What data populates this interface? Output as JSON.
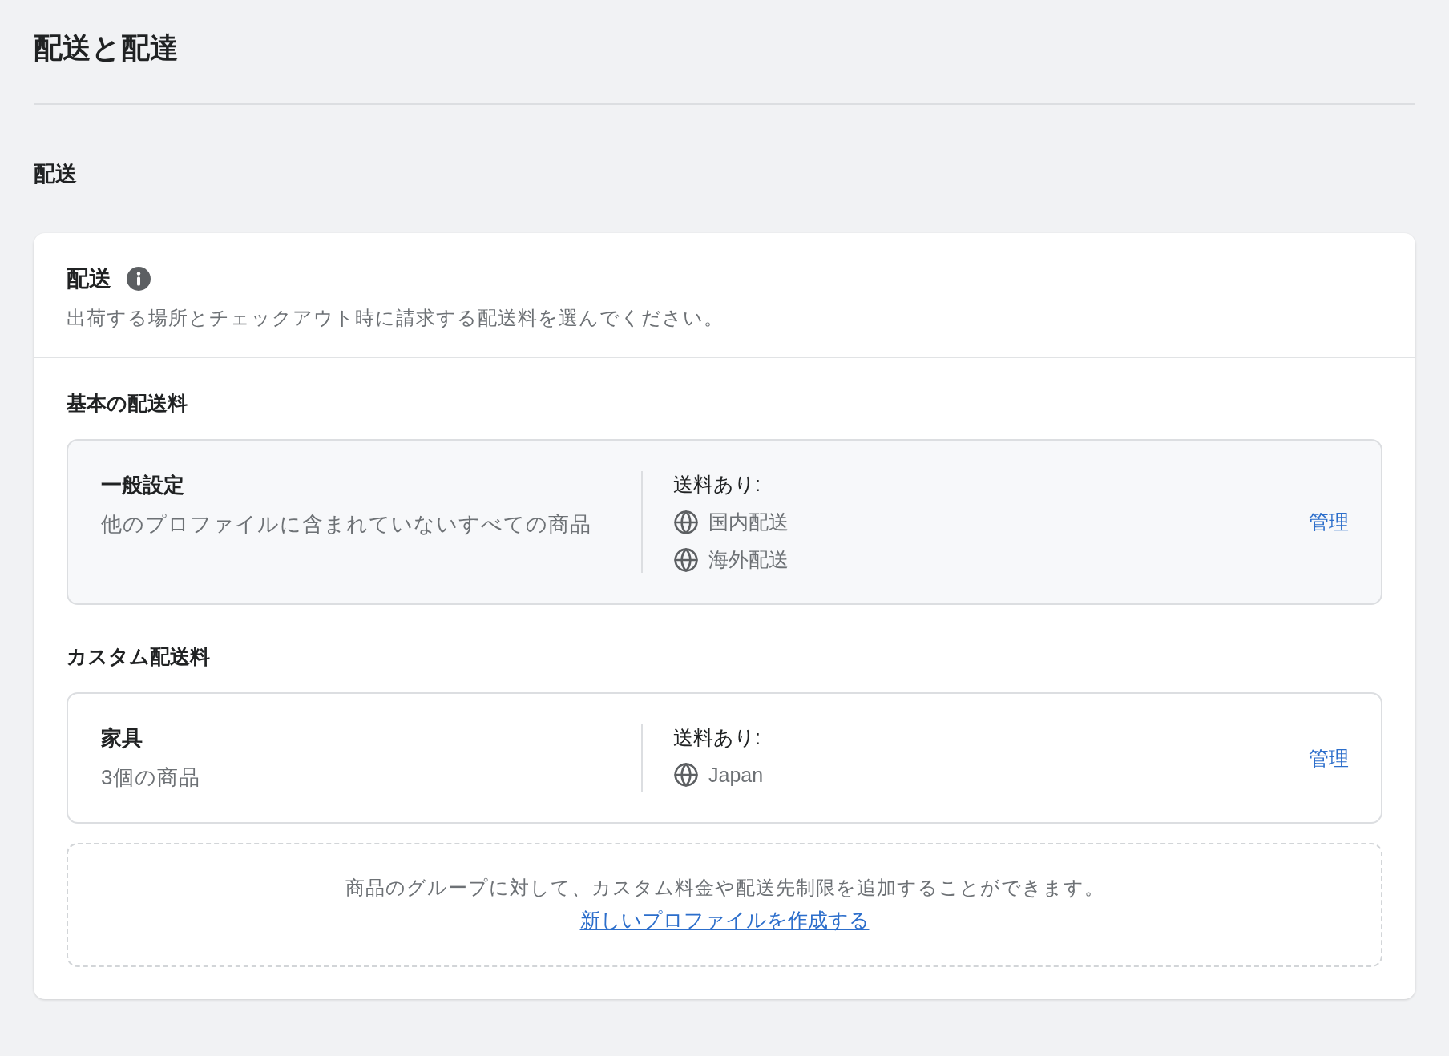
{
  "page_title": "配送と配達",
  "section_title": "配送",
  "card": {
    "title": "配送",
    "description": "出荷する場所とチェックアウト時に請求する配送料を選んでください。",
    "groups": [
      {
        "heading": "基本の配送料",
        "kind": "general",
        "profiles": [
          {
            "name": "一般設定",
            "subtitle": "他のプロファイルに含まれていないすべての商品",
            "rates_label": "送料あり:",
            "zones": [
              "国内配送",
              "海外配送"
            ],
            "action": "管理"
          }
        ]
      },
      {
        "heading": "カスタム配送料",
        "kind": "custom",
        "profiles": [
          {
            "name": "家具",
            "subtitle": "3個の商品",
            "rates_label": "送料あり:",
            "zones": [
              "Japan"
            ],
            "action": "管理"
          }
        ]
      }
    ],
    "footer": {
      "text": "商品のグループに対して、カスタム料金や配送先制限を追加することができます。",
      "link": "新しいプロファイルを作成する"
    }
  }
}
